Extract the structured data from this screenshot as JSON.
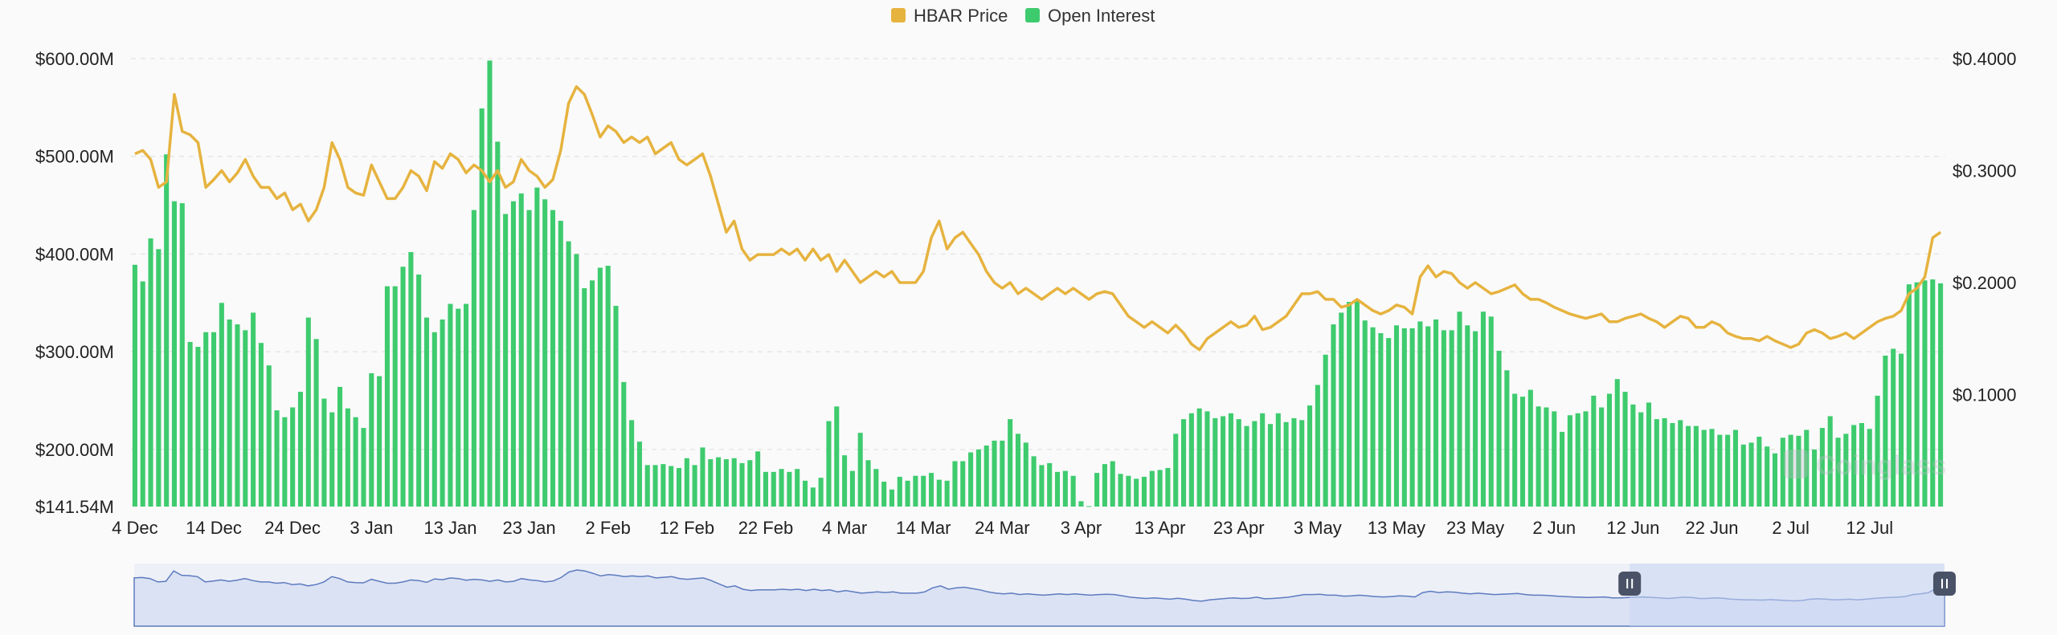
{
  "chart_data": {
    "type": "bar+line",
    "legend": [
      {
        "name": "HBAR Price",
        "color": "#e6b33f"
      },
      {
        "name": "Open Interest",
        "color": "#3ecb6e"
      }
    ],
    "legend_position": "top-center",
    "left_axis": {
      "ticks": [
        "$600.00M",
        "$500.00M",
        "$400.00M",
        "$300.00M",
        "$200.00M",
        "$141.54M"
      ],
      "tick_values": [
        600,
        500,
        400,
        300,
        200,
        141.54
      ],
      "range": [
        141.54,
        600
      ],
      "unit": "M USD"
    },
    "right_axis": {
      "ticks": [
        "$0.4000",
        "$0.3000",
        "$0.2000",
        "$0.1000"
      ],
      "tick_values": [
        0.4,
        0.3,
        0.2,
        0.1
      ],
      "range": [
        0.0,
        0.4
      ]
    },
    "x_ticks": [
      "4 Dec",
      "14 Dec",
      "24 Dec",
      "3 Jan",
      "13 Jan",
      "23 Jan",
      "2 Feb",
      "12 Feb",
      "22 Feb",
      "4 Mar",
      "14 Mar",
      "24 Mar",
      "3 Apr",
      "13 Apr",
      "23 Apr",
      "3 May",
      "13 May",
      "23 May",
      "2 Jun",
      "12 Jun",
      "22 Jun",
      "2 Jul",
      "12 Jul"
    ],
    "x_start": "4 Dec",
    "x_end": "13 Jul",
    "grid": "horizontal-dashed",
    "open_interest_M": [
      389,
      372,
      416,
      405,
      502,
      454,
      452,
      310,
      305,
      320,
      320,
      350,
      333,
      328,
      322,
      340,
      309,
      286,
      240,
      233,
      243,
      259,
      335,
      313,
      252,
      238,
      264,
      242,
      233,
      222,
      278,
      275,
      367,
      367,
      387,
      402,
      379,
      335,
      320,
      333,
      349,
      344,
      349,
      445,
      549,
      598,
      515,
      441,
      454,
      462,
      445,
      468,
      456,
      445,
      434,
      413,
      400,
      365,
      373,
      386,
      388,
      347,
      269,
      230,
      208,
      184,
      184,
      185,
      183,
      181,
      191,
      184,
      202,
      190,
      192,
      190,
      191,
      186,
      189,
      198,
      177,
      177,
      180,
      177,
      180,
      168,
      161,
      171,
      229,
      244,
      194,
      178,
      217,
      189,
      180,
      167,
      159,
      172,
      168,
      173,
      173,
      176,
      169,
      168,
      188,
      188,
      197,
      200,
      204,
      209,
      209,
      231,
      216,
      207,
      193,
      184,
      186,
      177,
      178,
      173,
      147,
      142,
      176,
      185,
      188,
      175,
      173,
      170,
      172,
      178,
      179,
      181,
      216,
      231,
      237,
      242,
      239,
      232,
      234,
      237,
      231,
      224,
      229,
      237,
      226,
      237,
      228,
      232,
      230,
      245,
      266,
      297,
      328,
      340,
      351,
      352,
      332,
      325,
      319,
      314,
      327,
      324,
      324,
      331,
      326,
      333,
      322,
      322,
      341,
      327,
      321,
      341,
      336,
      301,
      281,
      257,
      254,
      261,
      244,
      243,
      239,
      218,
      235,
      237,
      239,
      255,
      243,
      257,
      272,
      259,
      246,
      238,
      248,
      231,
      232,
      227,
      230,
      224,
      224,
      220,
      221,
      215,
      215,
      220,
      205,
      207,
      213,
      203,
      196,
      212,
      215,
      214,
      220,
      200,
      222,
      234,
      212,
      216,
      225,
      227,
      221,
      255,
      296,
      303,
      298,
      369,
      371,
      373,
      374,
      370
    ],
    "open_interest_note": "daily values, 4 Dec to 13 Jul (222 days)",
    "hbar_price": [
      0.315,
      0.318,
      0.31,
      0.285,
      0.29,
      0.368,
      0.335,
      0.332,
      0.325,
      0.285,
      0.292,
      0.3,
      0.29,
      0.298,
      0.31,
      0.295,
      0.285,
      0.285,
      0.275,
      0.28,
      0.265,
      0.27,
      0.255,
      0.265,
      0.285,
      0.325,
      0.31,
      0.285,
      0.28,
      0.278,
      0.305,
      0.29,
      0.275,
      0.275,
      0.285,
      0.3,
      0.295,
      0.282,
      0.308,
      0.302,
      0.315,
      0.31,
      0.298,
      0.305,
      0.3,
      0.29,
      0.3,
      0.285,
      0.29,
      0.31,
      0.3,
      0.295,
      0.285,
      0.292,
      0.318,
      0.36,
      0.375,
      0.368,
      0.35,
      0.33,
      0.34,
      0.335,
      0.325,
      0.33,
      0.325,
      0.33,
      0.315,
      0.32,
      0.325,
      0.31,
      0.305,
      0.31,
      0.315,
      0.295,
      0.27,
      0.245,
      0.255,
      0.23,
      0.22,
      0.225,
      0.225,
      0.225,
      0.23,
      0.225,
      0.23,
      0.22,
      0.23,
      0.22,
      0.225,
      0.21,
      0.22,
      0.21,
      0.2,
      0.205,
      0.21,
      0.205,
      0.21,
      0.2,
      0.2,
      0.2,
      0.21,
      0.24,
      0.255,
      0.23,
      0.24,
      0.245,
      0.235,
      0.225,
      0.21,
      0.2,
      0.195,
      0.2,
      0.19,
      0.195,
      0.19,
      0.185,
      0.19,
      0.195,
      0.19,
      0.195,
      0.19,
      0.185,
      0.19,
      0.192,
      0.19,
      0.18,
      0.17,
      0.165,
      0.16,
      0.165,
      0.16,
      0.155,
      0.162,
      0.155,
      0.145,
      0.14,
      0.15,
      0.155,
      0.16,
      0.165,
      0.16,
      0.162,
      0.17,
      0.158,
      0.16,
      0.165,
      0.17,
      0.18,
      0.19,
      0.19,
      0.192,
      0.185,
      0.185,
      0.178,
      0.18,
      0.185,
      0.18,
      0.175,
      0.172,
      0.175,
      0.18,
      0.178,
      0.172,
      0.205,
      0.215,
      0.205,
      0.21,
      0.208,
      0.2,
      0.195,
      0.2,
      0.195,
      0.19,
      0.192,
      0.195,
      0.198,
      0.19,
      0.185,
      0.185,
      0.182,
      0.178,
      0.175,
      0.172,
      0.17,
      0.168,
      0.17,
      0.172,
      0.165,
      0.165,
      0.168,
      0.17,
      0.172,
      0.168,
      0.165,
      0.16,
      0.165,
      0.17,
      0.168,
      0.16,
      0.16,
      0.165,
      0.162,
      0.155,
      0.152,
      0.15,
      0.15,
      0.148,
      0.152,
      0.148,
      0.145,
      0.142,
      0.145,
      0.155,
      0.158,
      0.155,
      0.15,
      0.152,
      0.155,
      0.15,
      0.155,
      0.16,
      0.165,
      0.168,
      0.17,
      0.175,
      0.19,
      0.195,
      0.205,
      0.24,
      0.245
    ],
    "range_selector": {
      "window_start": "12 Jun",
      "window_end": "13 Jul"
    },
    "watermark": "Coinglass"
  }
}
